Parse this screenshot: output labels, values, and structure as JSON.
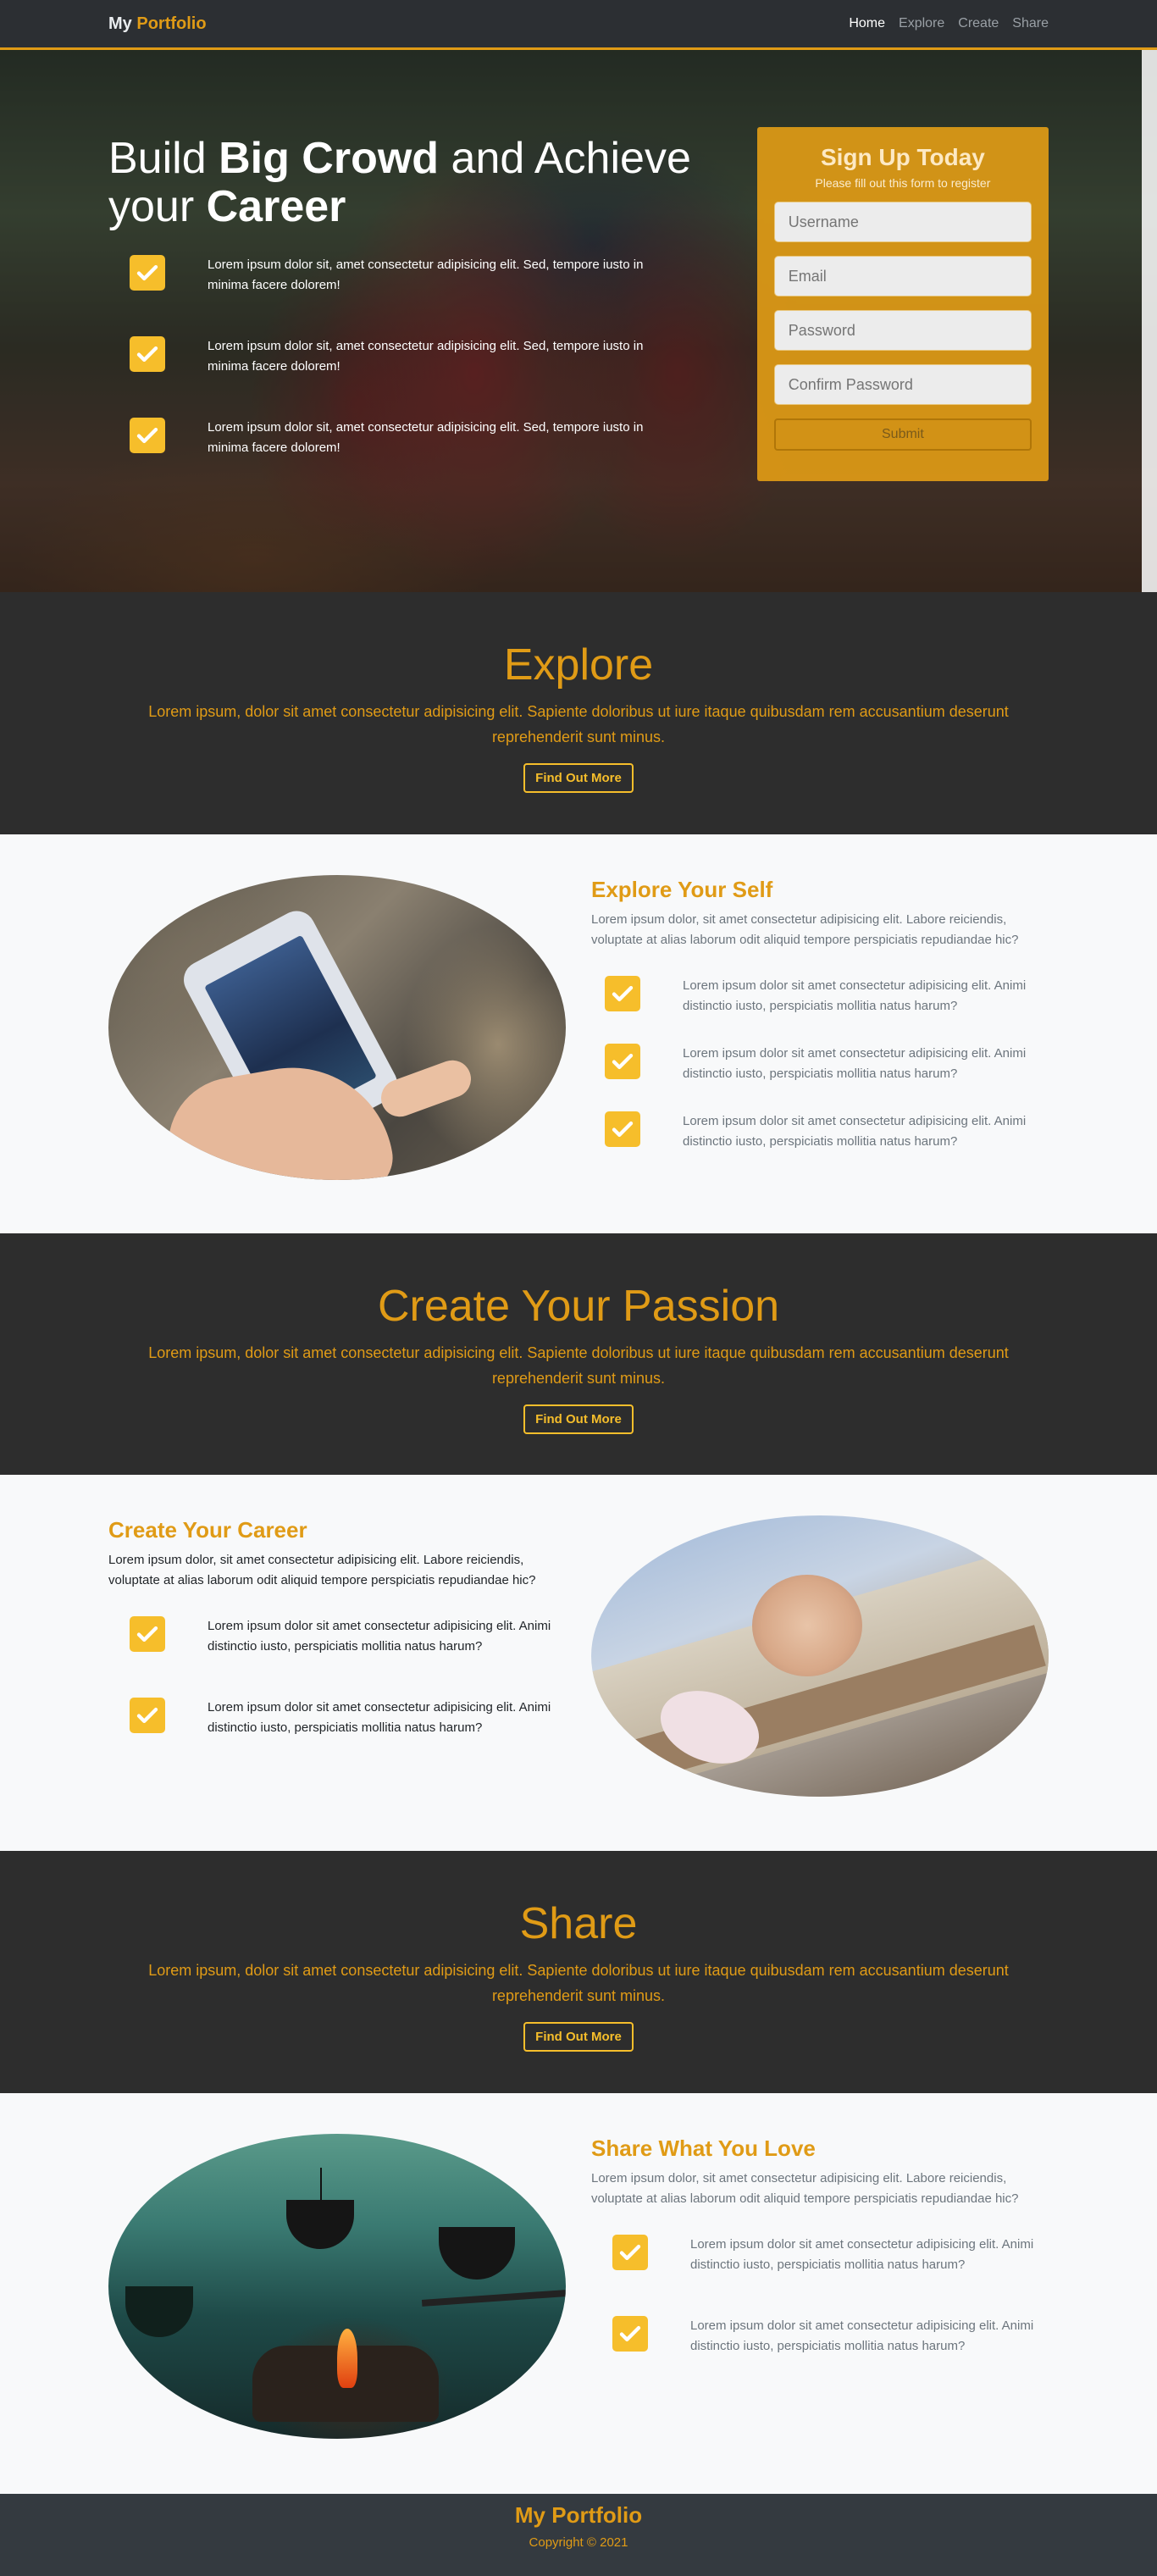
{
  "nav": {
    "brand_first": "My",
    "brand_second": "Portfolio",
    "links": [
      "Home",
      "Explore",
      "Create",
      "Share"
    ]
  },
  "hero": {
    "title_1": "Build",
    "title_2": "Big Crowd",
    "title_3": "and Achieve",
    "title_4": "your",
    "title_5": "Career",
    "features": [
      "Lorem ipsum dolor sit, amet consectetur adipisicing elit. Sed, tempore iusto in minima facere dolorem!",
      "Lorem ipsum dolor sit, amet consectetur adipisicing elit. Sed, tempore iusto in minima facere dolorem!",
      "Lorem ipsum dolor sit, amet consectetur adipisicing elit. Sed, tempore iusto in minima facere dolorem!"
    ]
  },
  "signup": {
    "title": "Sign Up Today",
    "subtitle": "Please fill out this form to register",
    "username_placeholder": "Username",
    "email_placeholder": "Email",
    "password_placeholder": "Password",
    "confirm_placeholder": "Confirm Password",
    "submit_label": "Submit"
  },
  "explore_band": {
    "title": "Explore",
    "text": "Lorem ipsum, dolor sit amet consectetur adipisicing elit. Sapiente doloribus ut iure itaque quibusdam rem accusantium deserunt reprehenderit sunt minus.",
    "button": "Find Out More"
  },
  "explore_section": {
    "title": "Explore Your Self",
    "text": "Lorem ipsum dolor, sit amet consectetur adipisicing elit. Labore reiciendis, voluptate at alias laborum odit aliquid tempore perspiciatis repudiandae hic?",
    "features": [
      "Lorem ipsum dolor sit amet consectetur adipisicing elit. Animi distinctio iusto, perspiciatis mollitia natus harum?",
      "Lorem ipsum dolor sit amet consectetur adipisicing elit. Animi distinctio iusto, perspiciatis mollitia natus harum?",
      "Lorem ipsum dolor sit amet consectetur adipisicing elit. Animi distinctio iusto, perspiciatis mollitia natus harum?"
    ]
  },
  "create_band": {
    "title": "Create Your Passion",
    "text": "Lorem ipsum, dolor sit amet consectetur adipisicing elit. Sapiente doloribus ut iure itaque quibusdam rem accusantium deserunt reprehenderit sunt minus.",
    "button": "Find Out More"
  },
  "create_section": {
    "title": "Create Your Career",
    "text": "Lorem ipsum dolor, sit amet consectetur adipisicing elit. Labore reiciendis, voluptate at alias laborum odit aliquid tempore perspiciatis repudiandae hic?",
    "features": [
      "Lorem ipsum dolor sit amet consectetur adipisicing elit. Animi distinctio iusto, perspiciatis mollitia natus harum?",
      "Lorem ipsum dolor sit amet consectetur adipisicing elit. Animi distinctio iusto, perspiciatis mollitia natus harum?"
    ]
  },
  "share_band": {
    "title": "Share",
    "text": "Lorem ipsum, dolor sit amet consectetur adipisicing elit. Sapiente doloribus ut iure itaque quibusdam rem accusantium deserunt reprehenderit sunt minus.",
    "button": "Find Out More"
  },
  "share_section": {
    "title": "Share What You Love",
    "text": "Lorem ipsum dolor, sit amet consectetur adipisicing elit. Labore reiciendis, voluptate at alias laborum odit aliquid tempore perspiciatis repudiandae hic?",
    "features": [
      "Lorem ipsum dolor sit amet consectetur adipisicing elit. Animi distinctio iusto, perspiciatis mollitia natus harum?",
      "Lorem ipsum dolor sit amet consectetur adipisicing elit. Animi distinctio iusto, perspiciatis mollitia natus harum?"
    ]
  },
  "footer": {
    "title": "My Portfolio",
    "copyright": "Copyright © 2021"
  },
  "colors": {
    "accent": "#e09b16",
    "check": "#f6be2b",
    "dark_band": "#2d2d2d",
    "light_bg": "#f8f9fa",
    "footer_bg": "#343a40"
  },
  "icons": {
    "feature_check": "check-icon"
  }
}
